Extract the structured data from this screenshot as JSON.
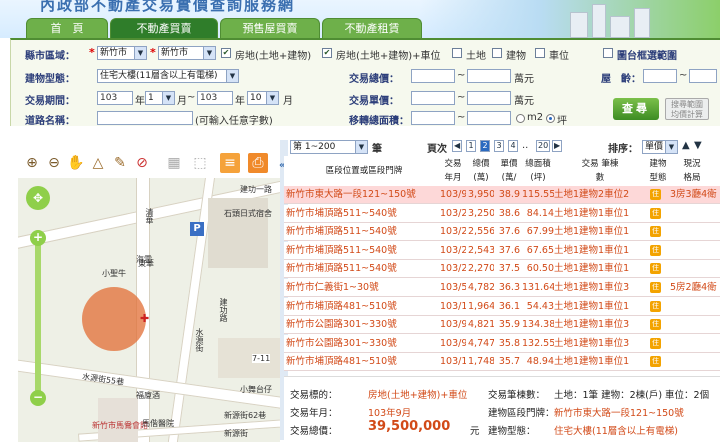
{
  "header": {
    "banner": "內政部不動產交易實價查詢服務網",
    "tabs": [
      {
        "label": "首　頁"
      },
      {
        "label": "不動產買賣"
      },
      {
        "label": "預售屋買賣"
      },
      {
        "label": "不動產租賃"
      }
    ]
  },
  "search": {
    "district_label": "縣市區域：",
    "city": "新竹市",
    "district": "新竹市",
    "options": [
      {
        "label": "房地(土地+建物)",
        "checked": true
      },
      {
        "label": "房地(土地+建物)+車位",
        "checked": true
      },
      {
        "label": "土地",
        "checked": false
      },
      {
        "label": "建物",
        "checked": false
      },
      {
        "label": "車位",
        "checked": false
      }
    ],
    "map_select": {
      "label": "圖台框選範圍",
      "checked": false
    },
    "building_type_label": "建物型態：",
    "building_type": "住宅大樓(11層含以上有電梯)",
    "total_price_label": "交易總價：",
    "total_price_unit": "萬元",
    "age_label": "屋　齡：",
    "period_label": "交易期間：",
    "period_start_year": "103",
    "period_start_month": "1",
    "period_end_year": "103",
    "period_end_month": "10",
    "year_unit": "年",
    "month_unit": "月",
    "unit_price_label": "交易單價：",
    "unit_price_unit": "萬元",
    "road_label": "道路名稱：",
    "road_hint": "(可輸入任意字數)",
    "area_label": "移轉總面積：",
    "area_unit_m2": "m2",
    "area_unit_ping": "坪",
    "search_button": "查尋",
    "range_button": "搜尋範圍 均價計算"
  },
  "map": {
    "labels": [
      "建功一路",
      "石頭日式宿舍",
      "清華",
      "東華",
      "小聖牛",
      "海雲",
      "水源街55巷",
      "福廈酒",
      "新竹市馬鴦會館",
      "馬偕醫院",
      "水源街",
      "7-11",
      "小舞台仔",
      "建功路",
      "新源街62巷",
      "新源街"
    ]
  },
  "results": {
    "page_range": "第 1~200",
    "page_unit": "筆",
    "page_label": "頁次",
    "pages": [
      "1",
      "2",
      "3",
      "4",
      "20"
    ],
    "current_page": "2",
    "sort_label": "排序：",
    "sort_value": "單價",
    "columns": [
      "區段位置或區段門牌",
      "交易 年月",
      "總價 (萬)",
      "單價 (萬/坪)",
      "總面積 (坪)",
      "交易 筆棟數",
      "建物 型態",
      "現況 格局"
    ],
    "rows": [
      {
        "address": "新竹市東大路一段121~150號",
        "date": "103/9",
        "total": "3,950",
        "unit": "38.9",
        "area": "115.55",
        "items": "土地1建物2車位2",
        "type": "住",
        "layout": "3房3廳4衛"
      },
      {
        "address": "新竹市埔頂路511~540號",
        "date": "103/2",
        "total": "3,250",
        "unit": "38.6",
        "area": "84.14",
        "items": "土地1建物1車位1",
        "type": "住",
        "layout": ""
      },
      {
        "address": "新竹市埔頂路511~540號",
        "date": "103/2",
        "total": "2,556",
        "unit": "37.6",
        "area": "67.99",
        "items": "土地1建物1車位1",
        "type": "住",
        "layout": ""
      },
      {
        "address": "新竹市埔頂路511~540號",
        "date": "103/2",
        "total": "2,543",
        "unit": "37.6",
        "area": "67.65",
        "items": "土地1建物1車位1",
        "type": "住",
        "layout": ""
      },
      {
        "address": "新竹市埔頂路511~540號",
        "date": "103/2",
        "total": "2,270",
        "unit": "37.5",
        "area": "60.50",
        "items": "土地1建物1車位1",
        "type": "住",
        "layout": ""
      },
      {
        "address": "新竹市仁義街1~30號",
        "date": "103/5",
        "total": "4,782",
        "unit": "36.3",
        "area": "131.64",
        "items": "土地1建物1車位3",
        "type": "住",
        "layout": "5房2廳4衛"
      },
      {
        "address": "新竹市埔頂路481~510號",
        "date": "103/1",
        "total": "1,964",
        "unit": "36.1",
        "area": "54.43",
        "items": "土地1建物1車位1",
        "type": "住",
        "layout": ""
      },
      {
        "address": "新竹市公園路301~330號",
        "date": "103/9",
        "total": "4,821",
        "unit": "35.9",
        "area": "134.38",
        "items": "土地1建物1車位3",
        "type": "住",
        "layout": ""
      },
      {
        "address": "新竹市公園路301~330號",
        "date": "103/9",
        "total": "4,747",
        "unit": "35.8",
        "area": "132.55",
        "items": "土地1建物1車位3",
        "type": "住",
        "layout": ""
      },
      {
        "address": "新竹市埔頂路481~510號",
        "date": "103/1",
        "total": "1,748",
        "unit": "35.7",
        "area": "48.94",
        "items": "土地1建物1車位1",
        "type": "住",
        "layout": ""
      }
    ]
  },
  "detail": {
    "target_label": "交易標的：",
    "target_value": "房地(土地+建物)+車位",
    "count_label": "交易筆棟數：",
    "count_value": "土地：1筆 建物：2棟(戶) 車位：2個",
    "date_label": "交易年月：",
    "date_value": "103年9月",
    "address_label": "建物區段門牌：",
    "address_value": "新竹市東大路一段121~150號",
    "price_label": "交易總價：",
    "price_value": "39,500,000",
    "price_unit": "元",
    "type_label": "建物型態：",
    "type_value": "住宅大樓(11層含以上有電梯)"
  }
}
